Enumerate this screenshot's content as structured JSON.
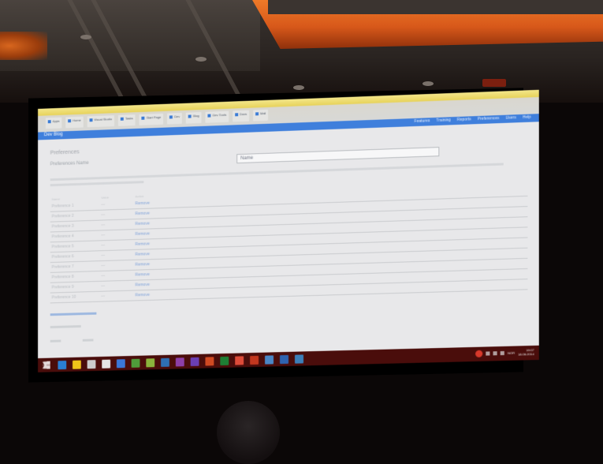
{
  "browser": {
    "bookmarks": [
      "Apps",
      "Home",
      "Visual Studio",
      "Tasks",
      "Start Page",
      "Dev",
      "Blog",
      "Dev Tools",
      "Docs",
      "Mail"
    ]
  },
  "app": {
    "brand": "Dev Blog",
    "nav_links": [
      "Features",
      "Training",
      "Reports",
      "Preferences",
      "Users",
      "Help"
    ]
  },
  "page": {
    "title": "Preferences",
    "form_label": "Preferences Name",
    "input_value": "Name"
  },
  "table": {
    "headers": [
      "Name",
      "Value",
      "Action"
    ],
    "rows": [
      {
        "name": "Preference 1",
        "value": "—",
        "action": "Remove"
      },
      {
        "name": "Preference 2",
        "value": "—",
        "action": "Remove"
      },
      {
        "name": "Preference 3",
        "value": "—",
        "action": "Remove"
      },
      {
        "name": "Preference 4",
        "value": "—",
        "action": "Remove"
      },
      {
        "name": "Preference 5",
        "value": "—",
        "action": "Remove"
      },
      {
        "name": "Preference 6",
        "value": "—",
        "action": "Remove"
      },
      {
        "name": "Preference 7",
        "value": "—",
        "action": "Remove"
      },
      {
        "name": "Preference 8",
        "value": "—",
        "action": "Remove"
      },
      {
        "name": "Preference 9",
        "value": "—",
        "action": "Remove"
      },
      {
        "name": "Preference 10",
        "value": "—",
        "action": "Remove"
      }
    ]
  },
  "taskbar": {
    "language": "NOR",
    "time": "19:07",
    "date": "18.06.2014",
    "icon_colors": [
      "#2a7fd4",
      "#f0c419",
      "#cccccc",
      "#e5e5e5",
      "#3b78d8",
      "#4f9c3a",
      "#8bb43c",
      "#2e6fb3",
      "#8d3fa8",
      "#6b3fb3",
      "#d04a22",
      "#1e7e34",
      "#dd4b39",
      "#c2371f",
      "#4a86c5",
      "#2f63b0",
      "#3c7fb9"
    ]
  },
  "colors": {
    "nav": "#3f7fdc",
    "taskbar": "#4a0d0b",
    "glow": "#ef7a28"
  }
}
